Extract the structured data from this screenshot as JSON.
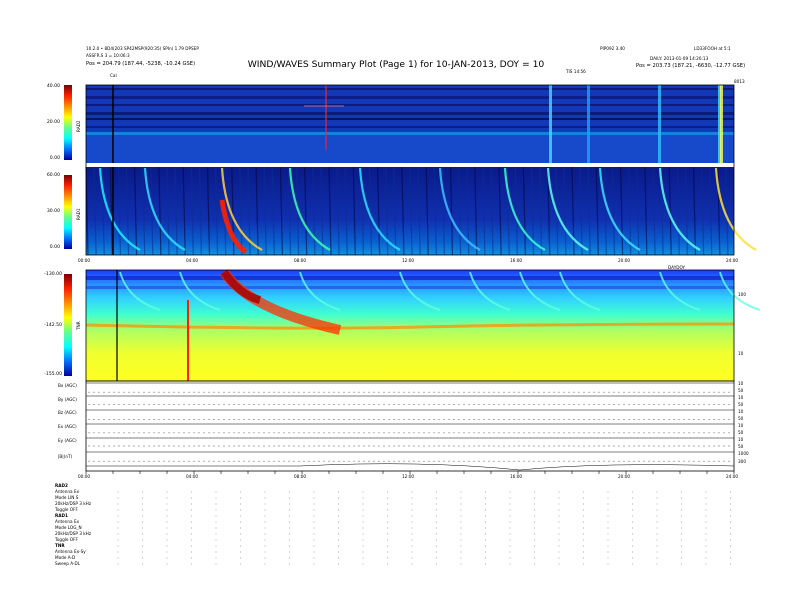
{
  "header": {
    "left_line1": "10.2.0 • 8D4(203 SP42MSP(920:35) SPIn) 1.79 DPSEP",
    "left_line2": "ASSFR.S 3 = 10:06:3",
    "left_line3": "Pos = 204.79 (187.44, -5238, -10.24 GSE)",
    "right_line1": "PIP092 3.40",
    "right_line1b": "LD33FOOH at 5:1",
    "right_line2": "DAILY: 2013-01-09 14:26:13",
    "right_line3": "Pos = 203.73 (187.21, -6630, -12.77 GSE)",
    "title": "WIND/WAVES Summary Plot (Page 1) for 10-JAN-2013, DOY = 10",
    "mark_left": "Cal",
    "mark_mid": "TIS 14:56",
    "mark_right": "8013"
  },
  "chart_data": [
    {
      "type": "heatmap",
      "panel": "RAD2",
      "ylabel": "RAD2",
      "yticks": [
        "40.00",
        "20.00",
        "0.00"
      ],
      "ylim": [
        0,
        40
      ],
      "colormap": [
        "#00008b",
        "#0000ff",
        "#00bfff",
        "#00ffff",
        "#7fff7f",
        "#ffff00",
        "#ff8000",
        "#ff0000",
        "#800000"
      ]
    },
    {
      "type": "heatmap",
      "panel": "RAD1",
      "ylabel": "RAD1",
      "yticks": [
        "60.00",
        "30.00",
        "0.00"
      ],
      "ylim": [
        0,
        60
      ],
      "xtick_labels": [
        "00:00",
        "04:00",
        "08:00",
        "12:00",
        "16:00",
        "20:00",
        "24:00"
      ],
      "x_right_label": "DAYDOY"
    },
    {
      "type": "heatmap",
      "panel": "TNR",
      "ylabel": "TNR",
      "yticks": [
        "-130.00",
        "-142.50",
        "-155.00"
      ],
      "ylim": [
        -155,
        -130
      ],
      "right_ticks": [
        "100",
        "10"
      ]
    },
    {
      "type": "line",
      "panel": "moments",
      "series": [
        {
          "name": "Bx (AGC)"
        },
        {
          "name": "By (AGC)"
        },
        {
          "name": "Bz (AGC)"
        },
        {
          "name": "Ex (AGC)"
        },
        {
          "name": "Ey (AGC)"
        },
        {
          "name": "|B|(nT)"
        }
      ],
      "right_ticks": [
        "10",
        "50",
        "10",
        "50",
        "10",
        "50",
        "10",
        "50",
        "10",
        "50",
        "1000",
        "300"
      ],
      "xtick_labels": [
        "00:00",
        "04:00",
        "08:00",
        "12:00",
        "16:00",
        "20:00",
        "24:00"
      ]
    }
  ],
  "footer": {
    "rad2_title": "RAD2",
    "rad2_rows": [
      "Antenna    Ex",
      "Mode    LIN S",
      "20kHz/DSP 3 kHz",
      "Toggle    OFF"
    ],
    "rad1_title": "RAD1",
    "rad1_rows": [
      "Antenna    Ex",
      "Mode  LOG_N",
      "20kHz/DSP 3 kHz",
      "Toggle    OFF"
    ],
    "tnr_title": "TNR",
    "tnr_rows": [
      "Antenna  Ex-Sy",
      "Mode     A-D",
      "Sweep   A-DL"
    ]
  }
}
